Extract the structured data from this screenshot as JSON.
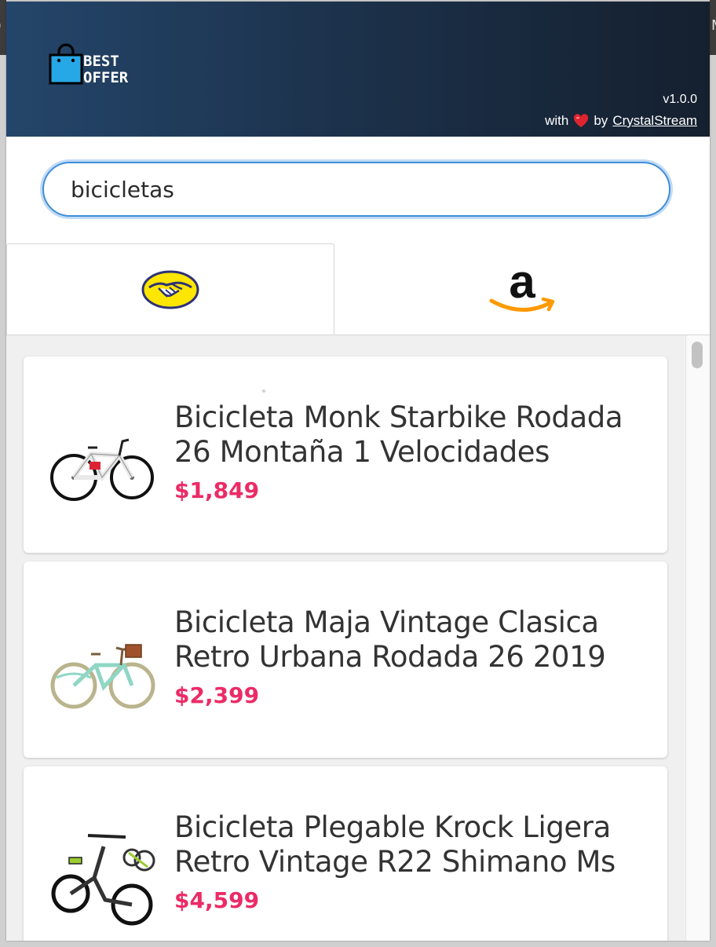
{
  "app": {
    "brand_line1": "BEST",
    "brand_line2": "OFFER",
    "version": "v1.0.0",
    "credits_prefix": "with",
    "credits_by": "by",
    "credits_author": "CrystalStream"
  },
  "colors": {
    "header_start": "#24456a",
    "header_end": "#15202f",
    "accent_blue": "#3f8fd9",
    "price": "#ec2b66",
    "logo_bag": "#27a8e6"
  },
  "search": {
    "value": "bicicletas"
  },
  "tabs": [
    {
      "name": "mercado-libre",
      "icon": "handshake-icon",
      "active": true
    },
    {
      "name": "amazon",
      "icon": "amazon-logo-icon",
      "active": false
    }
  ],
  "results": [
    {
      "title": "Bicicleta Monk Starbike Rodada 26 Montaña 1 Velocidades",
      "price": "$1,849",
      "image": "white-mountain-bike"
    },
    {
      "title": "Bicicleta Maja Vintage Clasica Retro Urbana Rodada 26 2019",
      "price": "$2,399",
      "image": "mint-vintage-bike"
    },
    {
      "title": "Bicicleta Plegable Krock Ligera Retro Vintage R22 Shimano Ms",
      "price": "$4,599",
      "image": "black-folding-bike"
    }
  ]
}
